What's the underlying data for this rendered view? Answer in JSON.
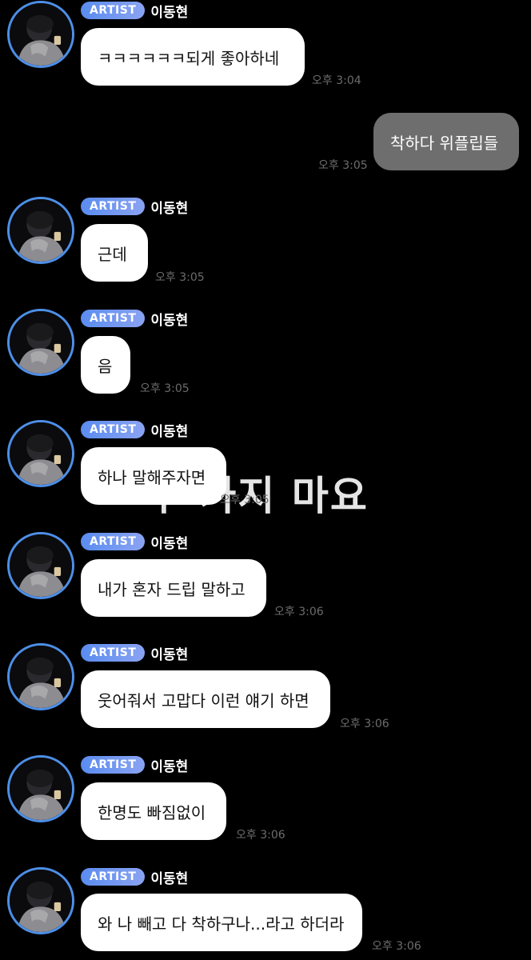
{
  "sender": {
    "badge": "ARTIST",
    "name": "이동현"
  },
  "overlay_caption": "두 가지 마요",
  "messages": [
    {
      "dir": "in",
      "text": "ㅋㅋㅋㅋㅋㅋ되게 좋아하네",
      "time": "오후 3:04"
    },
    {
      "dir": "out",
      "text": "착하다 위플립들",
      "time": "오후 3:05"
    },
    {
      "dir": "in",
      "text": "근데",
      "time": "오후 3:05"
    },
    {
      "dir": "in",
      "text": "음",
      "time": "오후 3:05"
    },
    {
      "dir": "in",
      "text": "하나 말해주자면",
      "time": "오후 3:05"
    },
    {
      "dir": "in",
      "text": "내가 혼자 드립 말하고",
      "time": "오후 3:06"
    },
    {
      "dir": "in",
      "text": "웃어줘서 고맙다 이런 얘기 하면",
      "time": "오후 3:06"
    },
    {
      "dir": "in",
      "text": "한명도 빠짐없이",
      "time": "오후 3:06"
    },
    {
      "dir": "in",
      "text": "와 나 빼고 다 착하구나...라고 하더라",
      "time": "오후 3:06"
    }
  ]
}
